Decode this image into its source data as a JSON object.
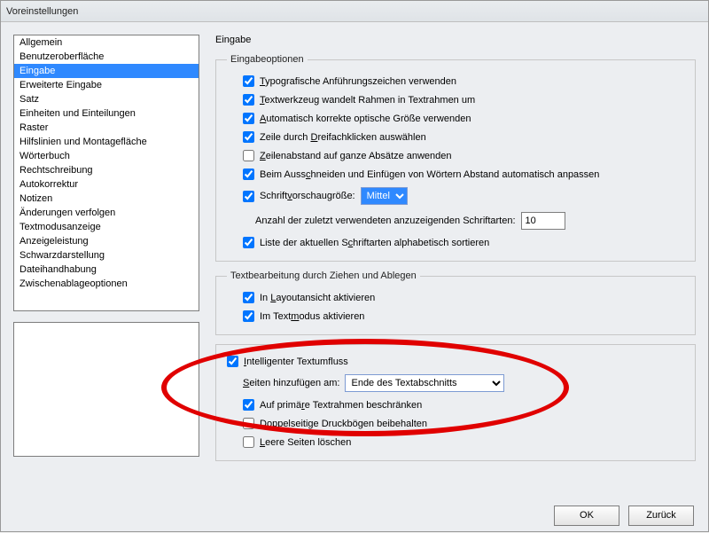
{
  "window": {
    "title": "Voreinstellungen"
  },
  "sidebar": {
    "items": [
      {
        "label": "Allgemein"
      },
      {
        "label": "Benutzeroberfläche"
      },
      {
        "label": "Eingabe"
      },
      {
        "label": "Erweiterte Eingabe"
      },
      {
        "label": "Satz"
      },
      {
        "label": "Einheiten und Einteilungen"
      },
      {
        "label": "Raster"
      },
      {
        "label": "Hilfslinien und Montagefläche"
      },
      {
        "label": "Wörterbuch"
      },
      {
        "label": "Rechtschreibung"
      },
      {
        "label": "Autokorrektur"
      },
      {
        "label": "Notizen"
      },
      {
        "label": "Änderungen verfolgen"
      },
      {
        "label": "Textmodusanzeige"
      },
      {
        "label": "Anzeigeleistung"
      },
      {
        "label": "Schwarzdarstellung"
      },
      {
        "label": "Dateihandhabung"
      },
      {
        "label": "Zwischenablageoptionen"
      }
    ],
    "selected_index": 2
  },
  "main": {
    "section_title": "Eingabe",
    "group1": {
      "legend": "Eingabeoptionen",
      "typographic_quotes": {
        "label": "Typografische Anführungszeichen verwenden",
        "checked": true
      },
      "text_tool_convert": {
        "label": "Textwerkzeug wandelt Rahmen in Textrahmen um",
        "checked": true
      },
      "optical_size": {
        "label": "Automatisch korrekte optische Größe verwenden",
        "checked": true
      },
      "triple_click": {
        "label": "Zeile durch Dreifachklicken auswählen",
        "checked": true
      },
      "leading_paragraph": {
        "label": "Zeilenabstand auf ganze Absätze anwenden",
        "checked": false
      },
      "cut_paste_spacing": {
        "label": "Beim Ausschneiden und Einfügen von Wörtern Abstand automatisch anpassen",
        "checked": true
      },
      "font_preview": {
        "label": "Schriftvorschaugröße:",
        "checked": true,
        "value": "Mittel"
      },
      "recent_fonts": {
        "label": "Anzahl der zuletzt verwendeten anzuzeigenden Schriftarten:",
        "value": "10"
      },
      "sort_fonts": {
        "label": "Liste der aktuellen Schriftarten alphabetisch sortieren",
        "checked": true
      }
    },
    "group2": {
      "legend": "Textbearbeitung durch Ziehen und Ablegen",
      "layout_view": {
        "label": "In Layoutansicht aktivieren",
        "checked": true
      },
      "text_mode": {
        "label": "Im Textmodus aktivieren",
        "checked": true
      }
    },
    "group3": {
      "smart_reflow": {
        "label": "Intelligenter Textumfluss",
        "checked": true
      },
      "add_pages": {
        "label": "Seiten hinzufügen am:",
        "value": "Ende des Textabschnitts"
      },
      "primary_frames": {
        "label": "Auf primäre Textrahmen beschränken",
        "checked": true
      },
      "facing_pages": {
        "label": "Doppelseitige Druckbögen beibehalten",
        "checked": false
      },
      "delete_empty": {
        "label": "Leere Seiten löschen",
        "checked": false
      }
    }
  },
  "footer": {
    "ok": "OK",
    "cancel": "Zurück"
  }
}
